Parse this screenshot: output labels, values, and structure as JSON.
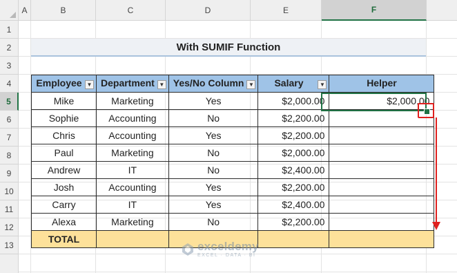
{
  "columns": [
    "A",
    "B",
    "C",
    "D",
    "E",
    "F"
  ],
  "rows": [
    "1",
    "2",
    "3",
    "4",
    "5",
    "6",
    "7",
    "8",
    "9",
    "10",
    "11",
    "12",
    "13"
  ],
  "selected": {
    "column": "F",
    "row": "5"
  },
  "title": "With SUMIF Function",
  "headers": {
    "employee": "Employee",
    "department": "Department",
    "yesno": "Yes/No Column",
    "salary": "Salary",
    "helper": "Helper"
  },
  "filter_icon": "chevron-down",
  "records": [
    {
      "employee": "Mike",
      "department": "Marketing",
      "yesno": "Yes",
      "salary": "$2,000.00",
      "helper": "$2,000.00"
    },
    {
      "employee": "Sophie",
      "department": "Accounting",
      "yesno": "No",
      "salary": "$2,200.00",
      "helper": ""
    },
    {
      "employee": "Chris",
      "department": "Accounting",
      "yesno": "Yes",
      "salary": "$2,200.00",
      "helper": ""
    },
    {
      "employee": "Paul",
      "department": "Marketing",
      "yesno": "No",
      "salary": "$2,000.00",
      "helper": ""
    },
    {
      "employee": "Andrew",
      "department": "IT",
      "yesno": "No",
      "salary": "$2,400.00",
      "helper": ""
    },
    {
      "employee": "Josh",
      "department": "Accounting",
      "yesno": "Yes",
      "salary": "$2,200.00",
      "helper": ""
    },
    {
      "employee": "Carry",
      "department": "IT",
      "yesno": "Yes",
      "salary": "$2,400.00",
      "helper": ""
    },
    {
      "employee": "Alexa",
      "department": "Marketing",
      "yesno": "No",
      "salary": "$2,200.00",
      "helper": ""
    }
  ],
  "total_label": "TOTAL",
  "watermark": {
    "name": "exceldemy",
    "tagline": "EXCEL · DATA · BI"
  },
  "colors": {
    "header_fill": "#9fc3e7",
    "total_fill": "#fde19a",
    "selection": "#217346",
    "annotation": "#e0201e"
  }
}
